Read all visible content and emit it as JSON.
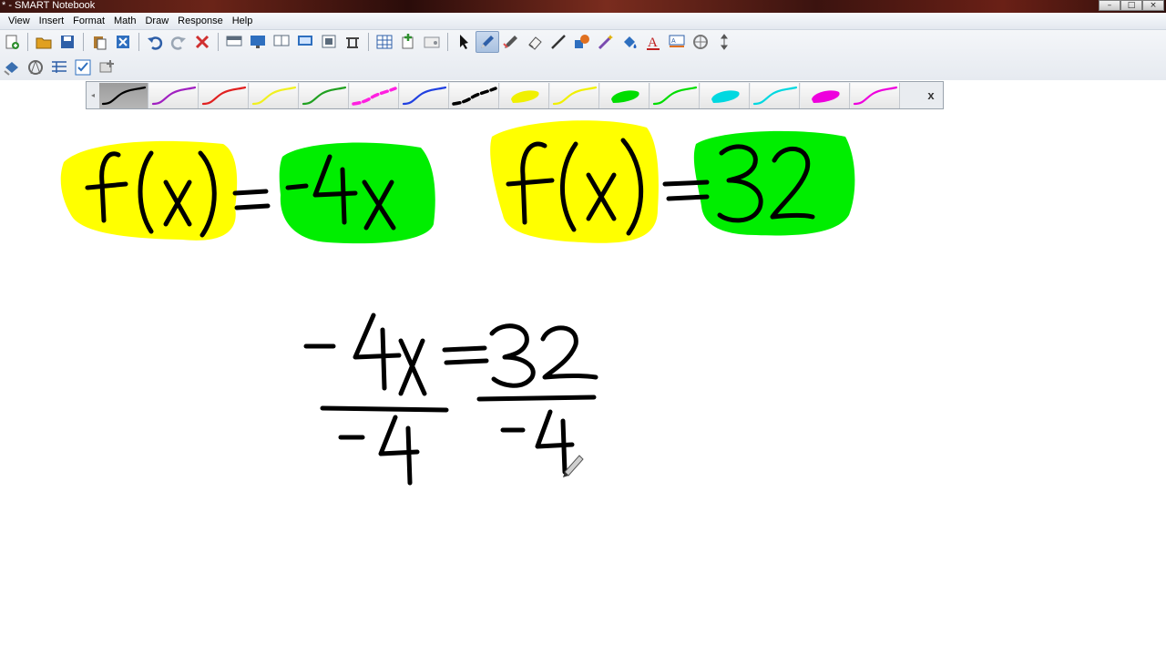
{
  "window": {
    "title": "* - SMART Notebook",
    "controls": [
      "–",
      "□",
      "×"
    ]
  },
  "menu": [
    "View",
    "Insert",
    "Format",
    "Math",
    "Draw",
    "Response",
    "Help"
  ],
  "toolbar_row1": [
    {
      "name": "new-page-icon",
      "color": "#2f8f2f"
    },
    {
      "sep": true
    },
    {
      "name": "open-folder-icon",
      "color": "#e0a020"
    },
    {
      "name": "save-icon",
      "color": "#2e5fa8"
    },
    {
      "sep": true
    },
    {
      "name": "paste-icon",
      "color": "#b07a30"
    },
    {
      "name": "close-icon",
      "color": "#2f6fbf"
    },
    {
      "sep": true
    },
    {
      "name": "undo-icon",
      "color": "#2e5fa8"
    },
    {
      "name": "redo-icon",
      "color": "#9aa6b4"
    },
    {
      "name": "delete-icon",
      "color": "#d03030"
    },
    {
      "sep": true
    },
    {
      "name": "screen-shade-icon",
      "color": "#5b6b7c"
    },
    {
      "name": "full-screen-icon",
      "color": "#2e6fbf"
    },
    {
      "name": "dual-page-icon",
      "color": "#5b6b7c"
    },
    {
      "name": "display-icon",
      "color": "#2e6fbf"
    },
    {
      "name": "screen-capture-icon",
      "color": "#5b6b7c"
    },
    {
      "name": "document-camera-icon",
      "color": "#444444"
    },
    {
      "sep": true
    },
    {
      "name": "table-icon",
      "color": "#2e5fa8"
    },
    {
      "name": "add-page-icon",
      "color": "#2f8f2f"
    },
    {
      "name": "properties-icon",
      "color": "#8a8f96"
    },
    {
      "sep": true
    },
    {
      "name": "select-arrow-icon",
      "color": "#111111"
    },
    {
      "name": "pen-icon",
      "color": "#2e5fa8",
      "active": true
    },
    {
      "name": "creative-pen-icon",
      "color": "#555555"
    },
    {
      "name": "eraser-icon",
      "color": "#555555"
    },
    {
      "name": "line-icon",
      "color": "#333333"
    },
    {
      "name": "shapes-icon",
      "color": "#e07020"
    },
    {
      "name": "magic-pen-icon",
      "color": "#7a4ab0"
    },
    {
      "name": "fill-icon",
      "color": "#2e6fbf"
    },
    {
      "name": "text-icon",
      "color": "#c02020"
    },
    {
      "name": "text-style-icon",
      "color": "#2e5fa8"
    },
    {
      "name": "measurement-tools-icon",
      "color": "#777777"
    },
    {
      "name": "move-toolbar-icon",
      "color": "#555555"
    }
  ],
  "toolbar_row2": [
    {
      "name": "fill-bucket-icon",
      "color": "#3a6fb0"
    },
    {
      "name": "compass-icon",
      "color": "#666666"
    },
    {
      "name": "table-tool-icon",
      "color": "#2e5fa8"
    },
    {
      "name": "check-grid-icon",
      "color": "#2e6fbf"
    },
    {
      "name": "add-ons-icon",
      "color": "#777777"
    }
  ],
  "pen_palette": {
    "close_label": "x",
    "swatches": [
      {
        "color": "#000000",
        "style": "line",
        "selected": true
      },
      {
        "color": "#a020c0",
        "style": "line"
      },
      {
        "color": "#e02020",
        "style": "line"
      },
      {
        "color": "#f0f020",
        "style": "line"
      },
      {
        "color": "#20a020",
        "style": "line"
      },
      {
        "color": "#ff20e0",
        "style": "dash"
      },
      {
        "color": "#2040e0",
        "style": "line"
      },
      {
        "color": "#000000",
        "style": "dash"
      },
      {
        "color": "#f0f000",
        "style": "blob"
      },
      {
        "color": "#f0f000",
        "style": "line"
      },
      {
        "color": "#00dd00",
        "style": "blob"
      },
      {
        "color": "#00dd00",
        "style": "line"
      },
      {
        "color": "#00d8e0",
        "style": "blob"
      },
      {
        "color": "#00d8e0",
        "style": "line"
      },
      {
        "color": "#ee00dd",
        "style": "blob"
      },
      {
        "color": "#ee00dd",
        "style": "line"
      }
    ]
  },
  "canvas": {
    "highlight_yellow": "#ffff00",
    "highlight_green": "#00ee00",
    "ink_color": "#000000"
  }
}
